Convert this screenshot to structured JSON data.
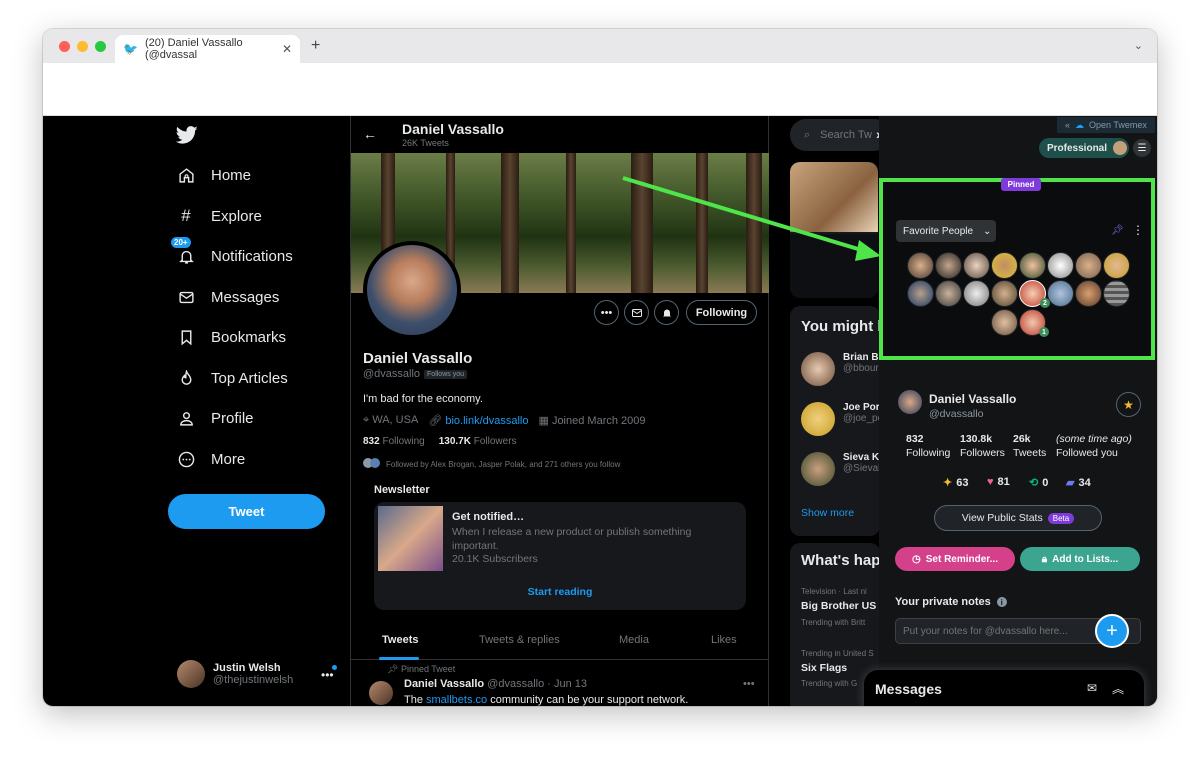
{
  "browser": {
    "tab_title": "(20) Daniel Vassallo (@dvassal",
    "new_tab": "+",
    "tab_close": "✕"
  },
  "nav": {
    "items": [
      {
        "label": "Home",
        "icon": "home-icon"
      },
      {
        "label": "Explore",
        "icon": "hash-icon"
      },
      {
        "label": "Notifications",
        "icon": "bell-icon",
        "badge": "20+"
      },
      {
        "label": "Messages",
        "icon": "mail-icon"
      },
      {
        "label": "Bookmarks",
        "icon": "bookmark-icon"
      },
      {
        "label": "Top Articles",
        "icon": "flame-icon"
      },
      {
        "label": "Profile",
        "icon": "person-icon"
      },
      {
        "label": "More",
        "icon": "more-circle-icon"
      }
    ],
    "tweet_button": "Tweet",
    "account": {
      "name": "Justin Welsh",
      "handle": "@thejustinwelsh"
    }
  },
  "profile": {
    "header_name": "Daniel Vassallo",
    "header_count": "26K Tweets",
    "following_label": "Following",
    "name": "Daniel Vassallo",
    "handle": "@dvassallo",
    "follows_you": "Follows you",
    "bio": "I'm bad for the economy.",
    "location": "WA, USA",
    "link": "bio.link/dvassallo",
    "joined": "Joined March 2009",
    "following_count": "832",
    "following_text": "Following",
    "followers_count": "130.7K",
    "followers_text": "Followers",
    "followed_by": "Followed by Alex Brogan, Jasper Polak, and 271 others you follow",
    "newsletter": {
      "title": "Newsletter",
      "heading": "Get notified…",
      "text": "When I release a new product or publish something important.",
      "subscribers": "20.1K Subscribers",
      "cta": "Start reading"
    },
    "tabs": [
      "Tweets",
      "Tweets & replies",
      "Media",
      "Likes"
    ],
    "pinned_label": "Pinned Tweet",
    "tweet": {
      "name": "Daniel Vassallo",
      "handle": "@dvassallo",
      "date": "· Jun 13",
      "text_pre": "The ",
      "text_link": "smallbets.co",
      "text_post": " community can be your support network."
    }
  },
  "right": {
    "search_placeholder": "Search Tw",
    "you_might_like": "You might li",
    "suggestions": [
      {
        "name": "Brian B",
        "handle": "@bbour"
      },
      {
        "name": "Joe Por",
        "handle": "@joe_po"
      },
      {
        "name": "Sieva K",
        "handle": "@Sieval"
      }
    ],
    "show_more": "Show more",
    "whats_happening": "What's hap",
    "trends": [
      {
        "meta": "Television · Last ni",
        "title": "Big Brother US",
        "sub": "Trending with Britt"
      },
      {
        "meta": "Trending in United S",
        "title": "Six Flags",
        "sub": "Trending with G"
      }
    ]
  },
  "twemex": {
    "open_label": "Open Twemex",
    "professional": "Professional",
    "pinned_tag": "Pinned",
    "list_name": "Favorite People",
    "badge_counts": [
      "2",
      "1"
    ],
    "card": {
      "name": "Daniel Vassallo",
      "handle": "@dvassallo",
      "stats": [
        {
          "value": "832",
          "label": "Following"
        },
        {
          "value": "130.8k",
          "label": "Followers"
        },
        {
          "value": "26k",
          "label": "Tweets"
        },
        {
          "value": "(some time ago)",
          "label": "Followed you"
        }
      ],
      "engagement": [
        {
          "icon": "sparkle-icon",
          "value": "63",
          "color": "#f5b82e"
        },
        {
          "icon": "heart-icon",
          "value": "81",
          "color": "#f0609c"
        },
        {
          "icon": "retweet-icon",
          "value": "0",
          "color": "#00ba7c"
        },
        {
          "icon": "reply-icon",
          "value": "34",
          "color": "#6c7cf0"
        }
      ],
      "view_stats": "View Public Stats",
      "beta": "Beta",
      "set_reminder": "Set Reminder...",
      "add_to_lists": "Add to Lists...",
      "notes_title": "Your private notes",
      "notes_placeholder": "Put your notes for @dvassallo here..."
    }
  },
  "messages_dock": {
    "title": "Messages"
  },
  "colors": {
    "accent": "#1d9bf0",
    "highlight": "#4ee44a",
    "purple": "#7f3bd9",
    "pink": "#d4408a",
    "teal": "#3ba58f"
  }
}
